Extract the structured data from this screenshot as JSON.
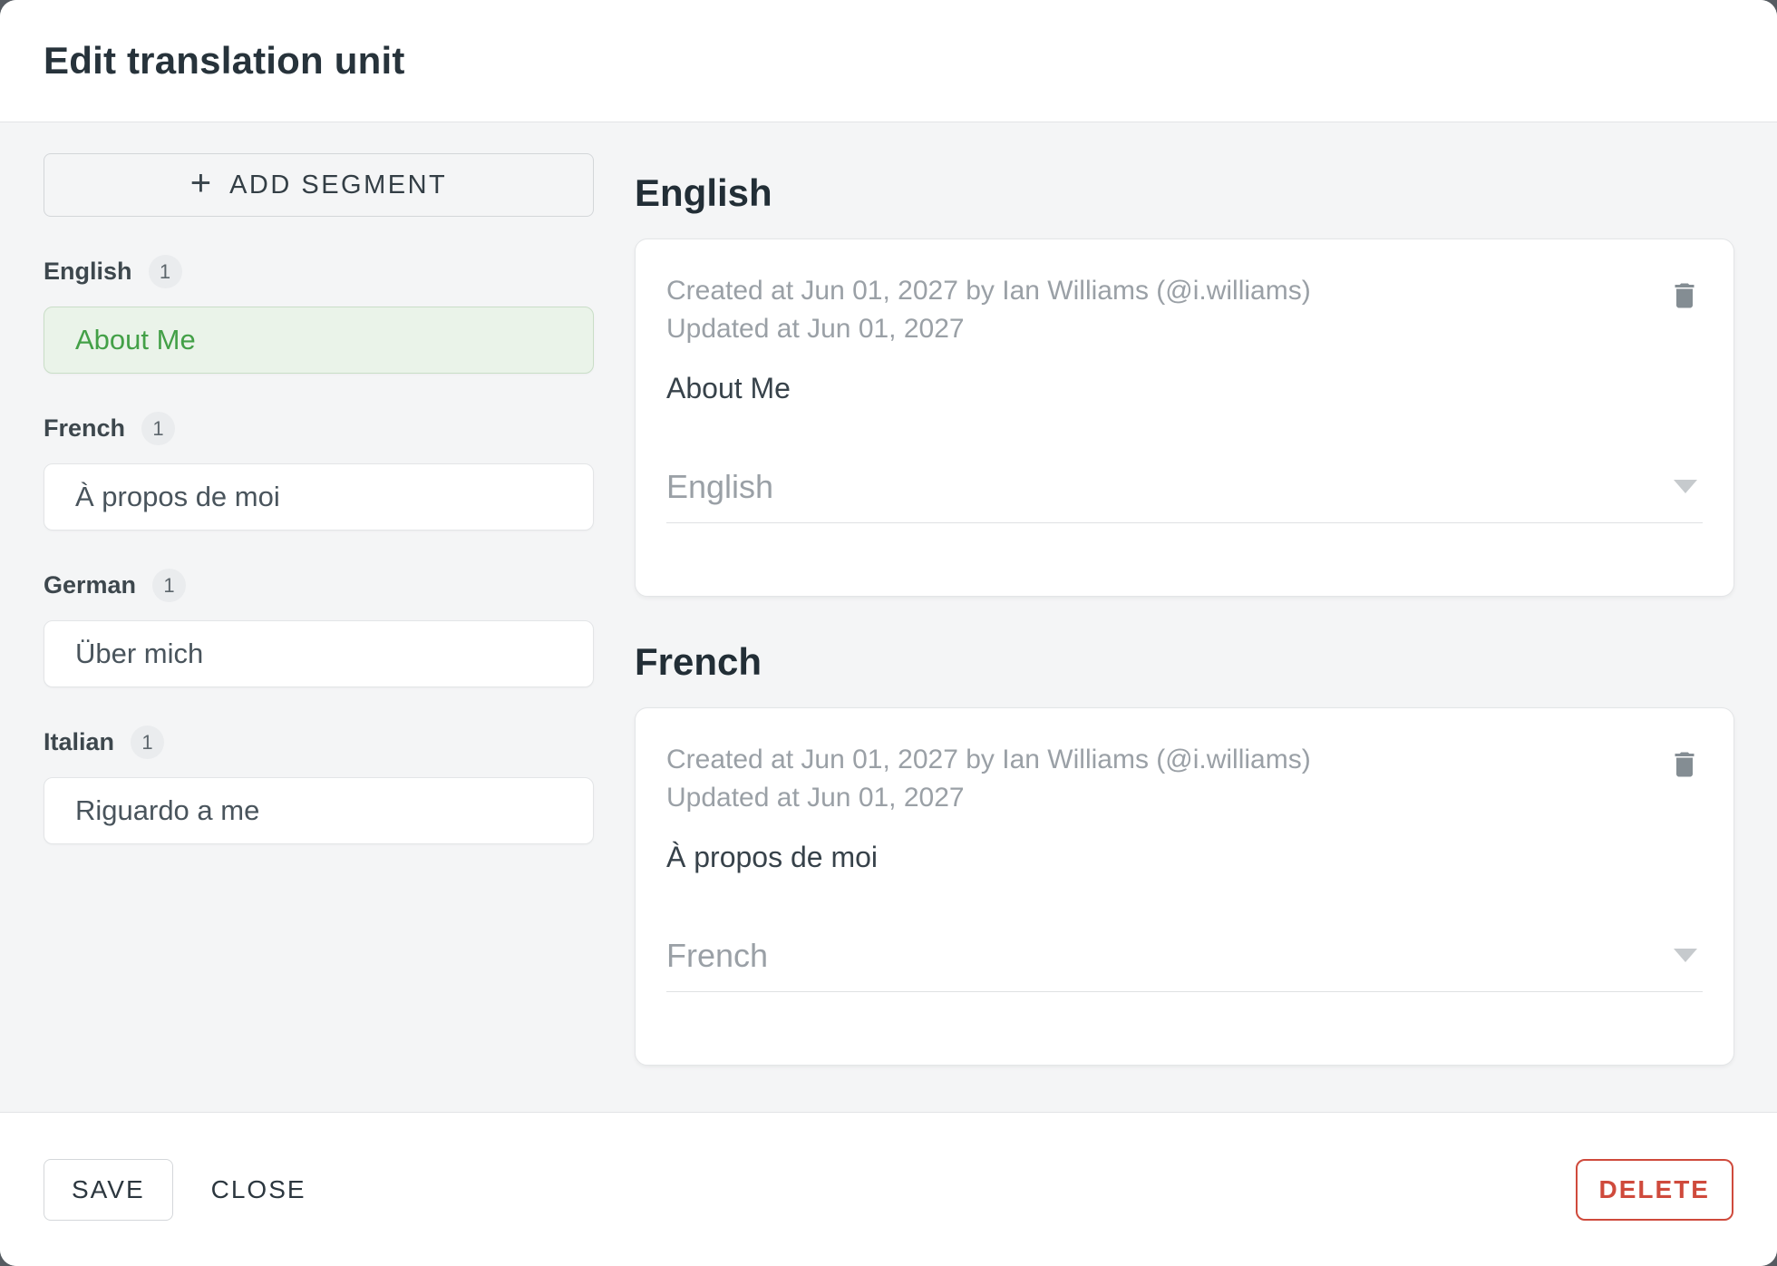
{
  "dialog": {
    "title": "Edit translation unit"
  },
  "sidebar": {
    "add_segment": {
      "icon_glyph": "+",
      "label": "ADD SEGMENT"
    },
    "groups": [
      {
        "language": "English",
        "count": "1",
        "segment_text": "About Me",
        "selected": true
      },
      {
        "language": "French",
        "count": "1",
        "segment_text": "À propos de moi",
        "selected": false
      },
      {
        "language": "German",
        "count": "1",
        "segment_text": "Über mich",
        "selected": false
      },
      {
        "language": "Italian",
        "count": "1",
        "segment_text": "Riguardo a me",
        "selected": false
      }
    ]
  },
  "main": {
    "sections": [
      {
        "heading": "English",
        "card": {
          "created": "Created at Jun 01, 2027 by Ian Williams (@i.williams)",
          "updated": "Updated at Jun 01, 2027",
          "text": "About Me",
          "language": "English"
        }
      },
      {
        "heading": "French",
        "card": {
          "created": "Created at Jun 01, 2027 by Ian Williams (@i.williams)",
          "updated": "Updated at Jun 01, 2027",
          "text": "À propos de moi",
          "language": "French"
        }
      }
    ]
  },
  "footer": {
    "save": "SAVE",
    "close": "CLOSE",
    "delete": "DELETE"
  },
  "colors": {
    "selected_segment_green": "#43a047",
    "selected_segment_bg": "#eaf3e9",
    "danger_red": "#cf4a3c",
    "backdrop": "#565b61"
  }
}
